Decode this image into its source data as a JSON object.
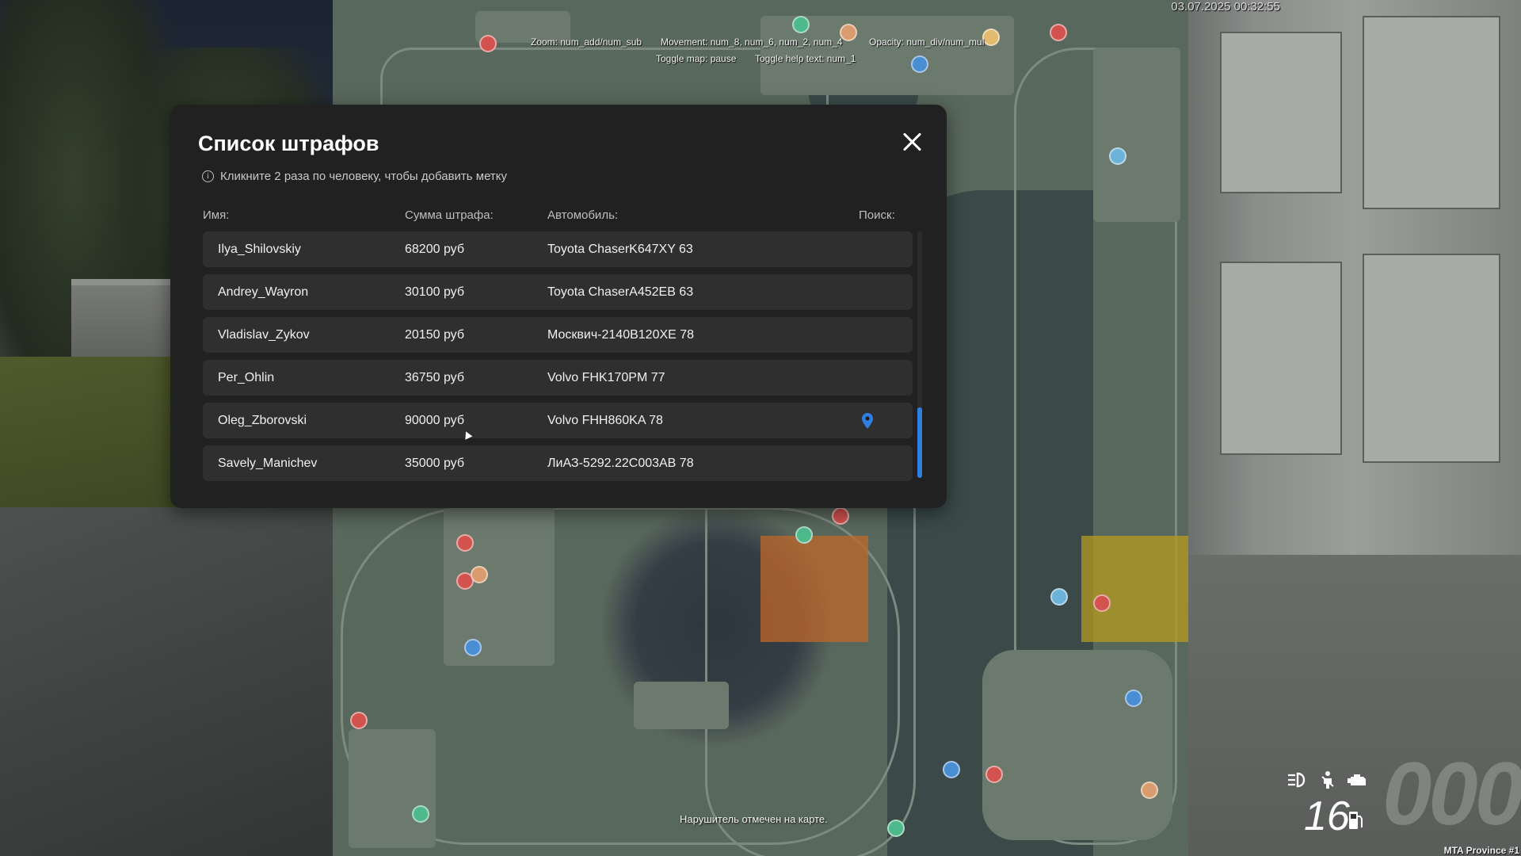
{
  "game": {
    "timestamp": "03.07.2025 00:32:55",
    "server_name": "MTA Province #1"
  },
  "map_help": {
    "zoom": "Zoom: num_add/num_sub",
    "movement": "Movement: num_8, num_6, num_2, num_4",
    "opacity": "Opacity: num_div/num_mul",
    "toggle_map": "Toggle map: pause",
    "toggle_help": "Toggle help text: num_1"
  },
  "status_message": "Нарушитель отмечен на карте.",
  "fines_dialog": {
    "title": "Список штрафов",
    "hint": "Кликните 2 раза по человеку, чтобы добавить метку",
    "columns": {
      "name": "Имя:",
      "amount": "Сумма штрафа:",
      "vehicle": "Автомобиль:",
      "search": "Поиск:"
    },
    "rows": [
      {
        "name": "Ilya_Shilovskiy",
        "amount": "68200 руб",
        "vehicle": "Toyota ChaserK647XY 63",
        "marked": false
      },
      {
        "name": "Andrey_Wayron",
        "amount": "30100 руб",
        "vehicle": "Toyota ChaserA452EB 63",
        "marked": false
      },
      {
        "name": "Vladislav_Zykov",
        "amount": "20150 руб",
        "vehicle": "Москвич-2140B120XE 78",
        "marked": false
      },
      {
        "name": "Per_Ohlin",
        "amount": "36750 руб",
        "vehicle": "Volvo FHK170PM 77",
        "marked": false
      },
      {
        "name": "Oleg_Zborovski",
        "amount": "90000 руб",
        "vehicle": "Volvo FHH860KA 78",
        "marked": true
      },
      {
        "name": "Savely_Manichev",
        "amount": "35000 руб",
        "vehicle": "ЛиАЗ-5292.22C003AB 78",
        "marked": false
      }
    ],
    "scroll_position": 1.0
  },
  "hud": {
    "speed": "000",
    "fuel": "16",
    "icons": [
      "headlight-icon",
      "seatbelt-icon",
      "engine-icon",
      "fuel-pump-icon"
    ]
  },
  "colors": {
    "dialog_bg": "#212121",
    "row_bg": "#2f2f2f",
    "accent_blue": "#2f7fe0",
    "zone_orange": "#c56a2a",
    "zone_yellow": "#b99f1f"
  }
}
